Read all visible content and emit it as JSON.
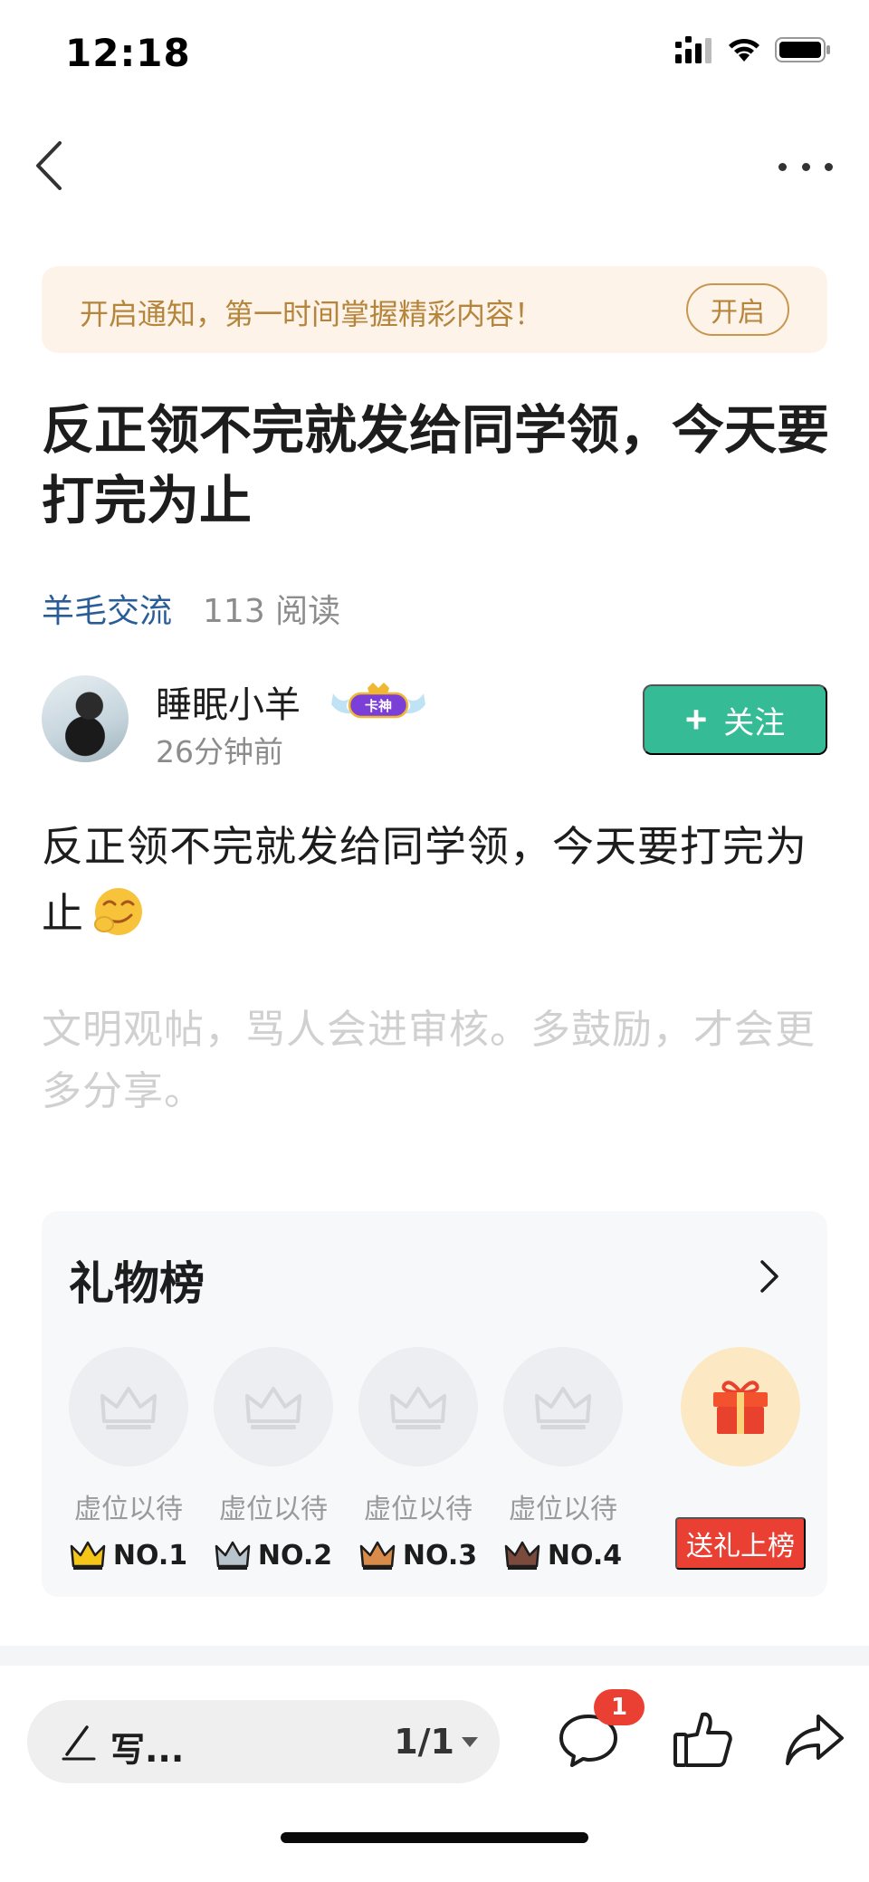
{
  "status_bar": {
    "time": "12:18",
    "icons": [
      "cellular-signal-icon",
      "wifi-icon",
      "battery-icon"
    ]
  },
  "nav": {
    "back_icon": "chevron-left-icon",
    "more_icon": "more-horizontal-icon"
  },
  "notify_banner": {
    "text": "开启通知，第一时间掌握精彩内容！",
    "button_label": "开启"
  },
  "post": {
    "title": "反正领不完就发给同学领，今天要打完为止",
    "category": "羊毛交流",
    "reads": "113 阅读",
    "body": "反正领不完就发给同学领，今天要打完为止",
    "hint": "文明观帖，骂人会进审核。多鼓励，才会更多分享。"
  },
  "author": {
    "name": "睡眠小羊",
    "badge": "卡神",
    "time": "26分钟前",
    "follow_label": "关注"
  },
  "gift_board": {
    "title": "礼物榜",
    "slots": [
      {
        "label": "虚位以待",
        "rank": "NO.1",
        "crown_color": "#f5c518"
      },
      {
        "label": "虚位以待",
        "rank": "NO.2",
        "crown_color": "#b9c3cc"
      },
      {
        "label": "虚位以待",
        "rank": "NO.3",
        "crown_color": "#d98c4a"
      },
      {
        "label": "虚位以待",
        "rank": "NO.4",
        "crown_color": "#7a4a3c"
      }
    ],
    "send_label": "送礼上榜"
  },
  "bottom_bar": {
    "comment_placeholder": "写...",
    "page_indicator": "1/1",
    "comment_count": "1"
  },
  "colors": {
    "accent_green": "#35bc97",
    "link_blue": "#2a5d98",
    "banner_bg": "#fdf3e9",
    "banner_text": "#b5853c",
    "badge_red": "#ea3f33"
  }
}
